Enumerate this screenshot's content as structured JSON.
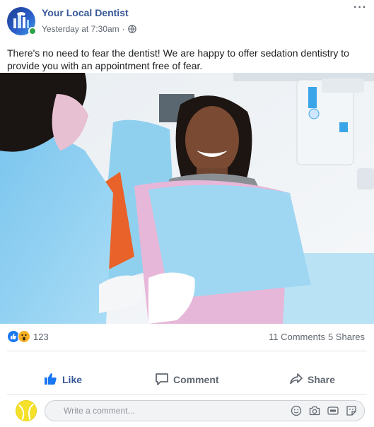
{
  "post": {
    "page_name": "Your Local Dentist",
    "timestamp": "Yesterday at 7:30am",
    "separator": "·",
    "more_label": "···",
    "text": "There's no need to fear the dentist! We are happy to offer sedation dentistry to provide you with an appointment free of fear."
  },
  "photo": {
    "icon": "dental-clinic-photo"
  },
  "engagement": {
    "reaction_icons": [
      "like-reaction-icon",
      "wow-reaction-icon"
    ],
    "reaction_count": "123",
    "comments": "11 Comments",
    "shares": "5 Shares"
  },
  "actions": {
    "like": "Like",
    "comment": "Comment",
    "share": "Share"
  },
  "composer": {
    "placeholder": "Write a comment...",
    "icons": [
      "emoji-icon",
      "camera-icon",
      "gif-icon",
      "sticker-icon"
    ]
  },
  "colors": {
    "link_blue": "#385898",
    "like_blue": "#1877f2",
    "muted": "#606770",
    "online_green": "#31a24c",
    "wow_yellow": "#f7b125"
  }
}
